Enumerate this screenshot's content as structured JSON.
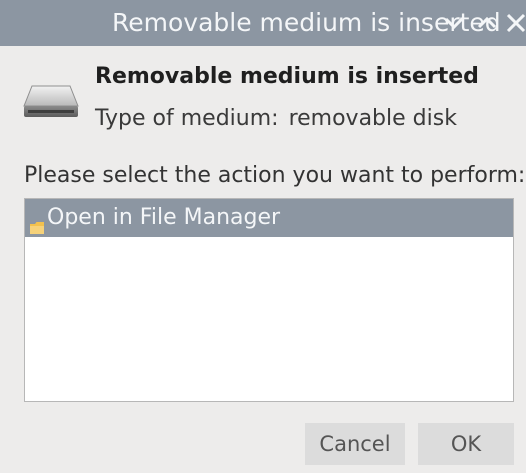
{
  "window": {
    "title": "Removable medium is inserted",
    "controls": [
      "minimize-icon",
      "maximize-icon",
      "close-icon"
    ]
  },
  "header": {
    "icon": "removable-disk-icon",
    "heading": "Removable medium is inserted",
    "type_label": "Type of medium:",
    "type_value": "removable disk"
  },
  "prompt": "Please select the action you want to perform:",
  "actions": [
    {
      "icon": "folder-icon",
      "label": "Open in File Manager",
      "selected": true
    }
  ],
  "buttons": {
    "cancel": "Cancel",
    "ok": "OK"
  },
  "colors": {
    "titlebar": "#8c96a2",
    "selection": "#8c96a2",
    "background": "#edeceb",
    "folder": "#f2c14e"
  }
}
